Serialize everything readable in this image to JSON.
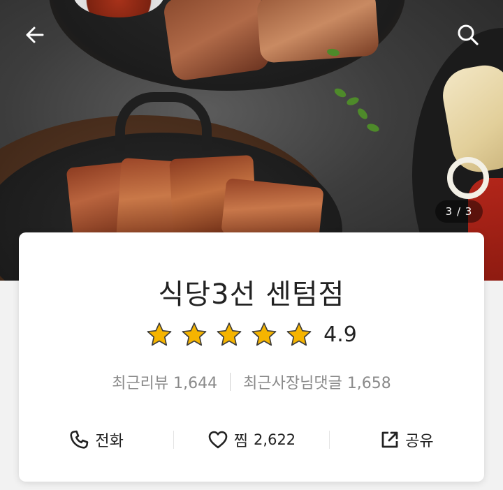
{
  "hero": {
    "image_counter": "3 / 3"
  },
  "header": {
    "back_icon": "arrow-left-icon",
    "search_icon": "search-icon"
  },
  "store": {
    "name": "식당3선 센텀점",
    "rating": {
      "stars": 5,
      "score": "4.9",
      "star_color": "#f5b400"
    },
    "recent_reviews_label": "최근리뷰 1,644",
    "recent_owner_replies_label": "최근사장님댓글 1,658"
  },
  "actions": {
    "call": {
      "icon": "phone-icon",
      "label": "전화"
    },
    "favorite": {
      "icon": "heart-icon",
      "label": "찜",
      "count": "2,622"
    },
    "share": {
      "icon": "share-icon",
      "label": "공유"
    }
  }
}
